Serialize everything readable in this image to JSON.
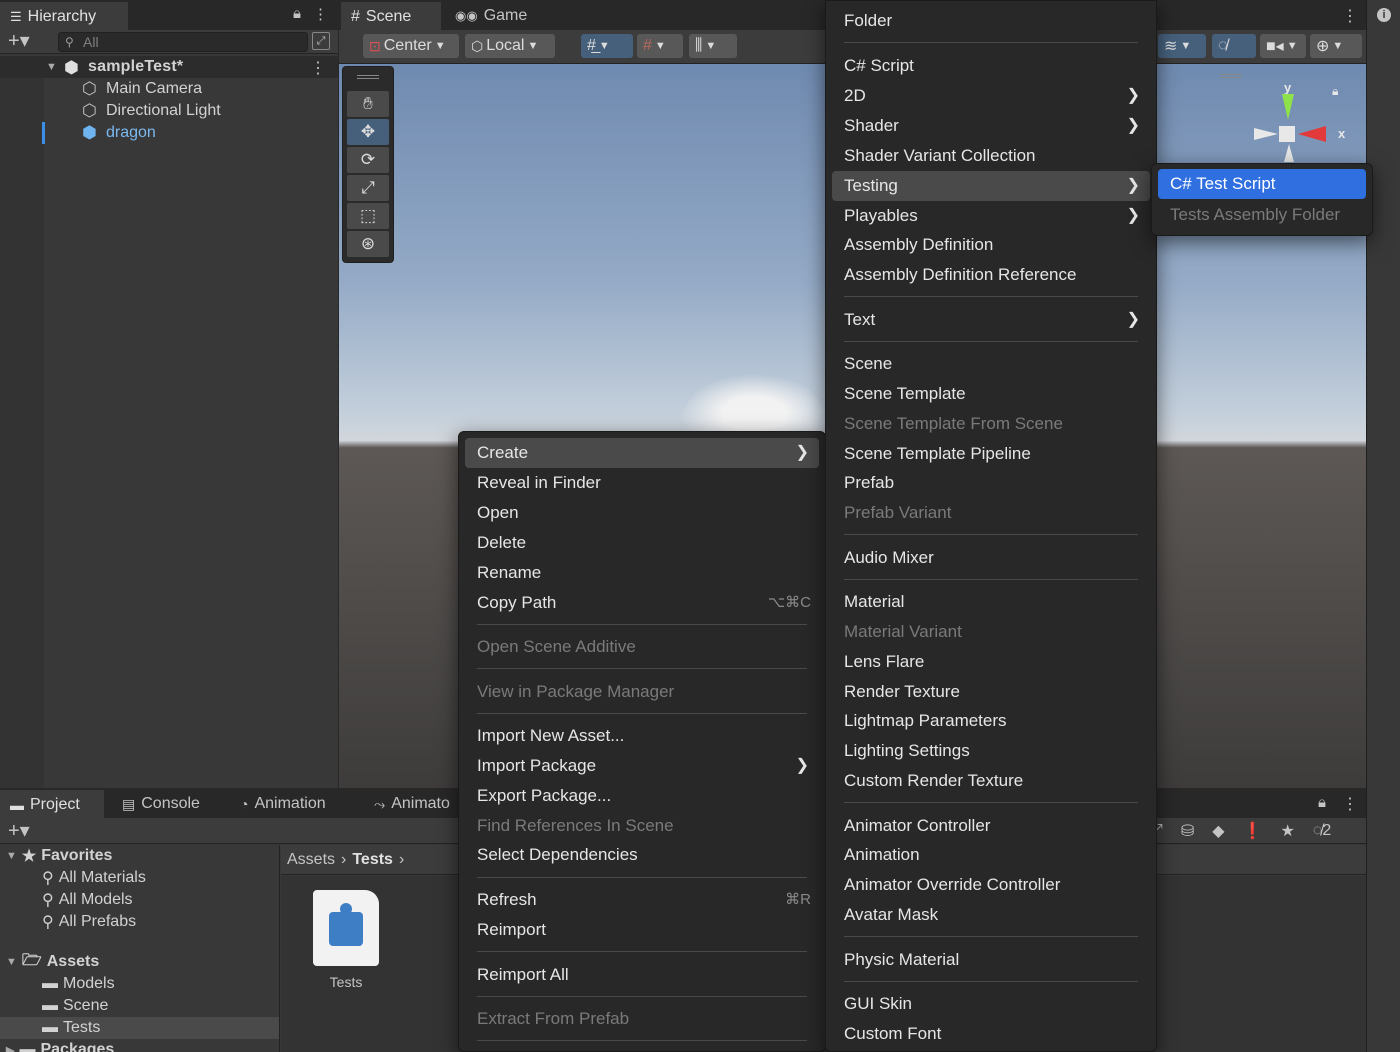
{
  "hierarchy": {
    "tab_label": "Hierarchy",
    "search_placeholder": "All",
    "scene_name": "sampleTest*",
    "objects": [
      "Main Camera",
      "Directional Light",
      "dragon"
    ]
  },
  "scene_view": {
    "tabs": [
      "Scene",
      "Game"
    ],
    "pivot_label": "Center",
    "space_label": "Local",
    "gizmo_axes": {
      "y": "y",
      "x": "x"
    }
  },
  "project": {
    "tabs": [
      "Project",
      "Console",
      "Animation",
      "Animato"
    ],
    "favorites_label": "Favorites",
    "favorites": [
      "All Materials",
      "All Models",
      "All Prefabs"
    ],
    "assets_label": "Assets",
    "asset_folders": [
      "Models",
      "Scene",
      "Tests"
    ],
    "packages_label": "Packages",
    "breadcrumb": {
      "root": "Assets",
      "current": "Tests"
    },
    "grid_items": [
      {
        "name": "Tests"
      }
    ],
    "hidden_count": "2"
  },
  "context_menu": {
    "items": [
      {
        "label": "Create",
        "arrow": ">"
      },
      {
        "label": "Reveal in Finder"
      },
      {
        "label": "Open"
      },
      {
        "label": "Delete"
      },
      {
        "label": "Rename"
      },
      {
        "label": "Copy Path",
        "shortcut": "⌥⌘C"
      },
      {
        "label": "Open Scene Additive"
      },
      {
        "label": "View in Package Manager"
      },
      {
        "label": "Import New Asset..."
      },
      {
        "label": "Import Package",
        "arrow": ">"
      },
      {
        "label": "Export Package..."
      },
      {
        "label": "Find References In Scene"
      },
      {
        "label": "Select Dependencies"
      },
      {
        "label": "Refresh",
        "shortcut": "⌘R"
      },
      {
        "label": "Reimport"
      },
      {
        "label": "Reimport All"
      },
      {
        "label": "Extract From Prefab"
      }
    ]
  },
  "create_menu": {
    "items": [
      {
        "label": "Folder"
      },
      {
        "label": "C# Script"
      },
      {
        "label": "2D",
        "arrow": ">"
      },
      {
        "label": "Shader",
        "arrow": ">"
      },
      {
        "label": "Shader Variant Collection"
      },
      {
        "label": "Testing",
        "arrow": ">"
      },
      {
        "label": "Playables",
        "arrow": ">"
      },
      {
        "label": "Assembly Definition"
      },
      {
        "label": "Assembly Definition Reference"
      },
      {
        "label": "Text",
        "arrow": ">"
      },
      {
        "label": "Scene"
      },
      {
        "label": "Scene Template"
      },
      {
        "label": "Scene Template From Scene"
      },
      {
        "label": "Scene Template Pipeline"
      },
      {
        "label": "Prefab"
      },
      {
        "label": "Prefab Variant"
      },
      {
        "label": "Audio Mixer"
      },
      {
        "label": "Material"
      },
      {
        "label": "Material Variant"
      },
      {
        "label": "Lens Flare"
      },
      {
        "label": "Render Texture"
      },
      {
        "label": "Lightmap Parameters"
      },
      {
        "label": "Lighting Settings"
      },
      {
        "label": "Custom Render Texture"
      },
      {
        "label": "Animator Controller"
      },
      {
        "label": "Animation"
      },
      {
        "label": "Animator Override Controller"
      },
      {
        "label": "Avatar Mask"
      },
      {
        "label": "Physic Material"
      },
      {
        "label": "GUI Skin"
      },
      {
        "label": "Custom Font"
      }
    ]
  },
  "testing_menu": {
    "items": [
      {
        "label": "C# Test Script"
      },
      {
        "label": "Tests Assembly Folder"
      }
    ]
  },
  "colors": {
    "selection": "#2f6fe0",
    "accent": "#3a8ee6",
    "menu_bg": "#282828"
  }
}
